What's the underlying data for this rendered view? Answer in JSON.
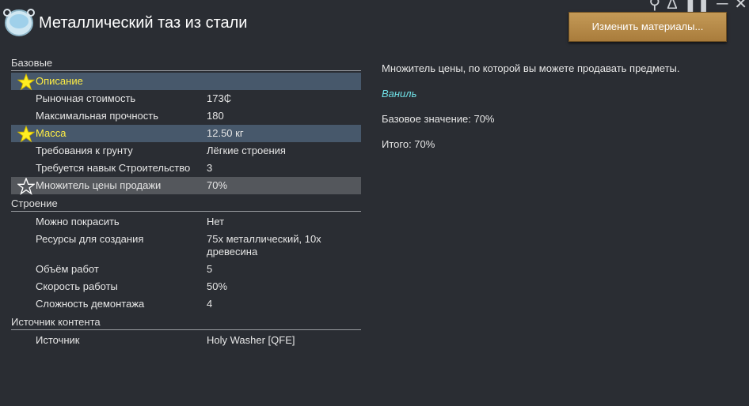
{
  "window": {
    "title": "Металлический таз из стали",
    "change_materials": "Изменить материалы..."
  },
  "header_icons": [
    "search-icon",
    "triangle-icon",
    "pause-icon",
    "minimize-icon",
    "close-icon"
  ],
  "sections": [
    {
      "label": "Базовые",
      "rows": [
        {
          "key": "Описание",
          "value": "",
          "star": "filled",
          "highlight": "blue",
          "yellow_value": true
        },
        {
          "key": "Рыночная стоимость",
          "value": "173₵"
        },
        {
          "key": "Максимальная прочность",
          "value": "180"
        },
        {
          "key": "Масса",
          "value": "12.50 кг",
          "star": "filled",
          "highlight": "blue",
          "yellow_value": true
        },
        {
          "key": "Требования к грунту",
          "value": "Лёгкие строения"
        },
        {
          "key": "Требуется навык Строительство",
          "value": "3"
        },
        {
          "key": "Множитель цены продажи",
          "value": "70%",
          "star": "outline",
          "highlight": "grey"
        }
      ]
    },
    {
      "label": "Строение",
      "rows": [
        {
          "key": "Можно покрасить",
          "value": "Нет"
        },
        {
          "key": "Ресурсы для создания",
          "value": "75х металлический, 10х древесина"
        },
        {
          "key": "Объём работ",
          "value": "5"
        },
        {
          "key": "Скорость работы",
          "value": "50%"
        },
        {
          "key": "Сложность демонтажа",
          "value": "4"
        }
      ]
    },
    {
      "label": "Источник контента",
      "rows": [
        {
          "key": "Источник",
          "value": "Holy Washer [QFE]"
        }
      ]
    }
  ],
  "detail": {
    "description": "Множитель цены, по которой вы можете продавать предметы.",
    "source": "Ваниль",
    "base_value": "Базовое значение: 70%",
    "total": "Итого: 70%"
  },
  "colors": {
    "background": "#2a2d33",
    "highlight_blue": "#47586b",
    "highlight_grey": "#54575c",
    "yellow_text": "#ffee44",
    "vanilla_text": "#6fe0e6",
    "button": "#b98c4a"
  }
}
